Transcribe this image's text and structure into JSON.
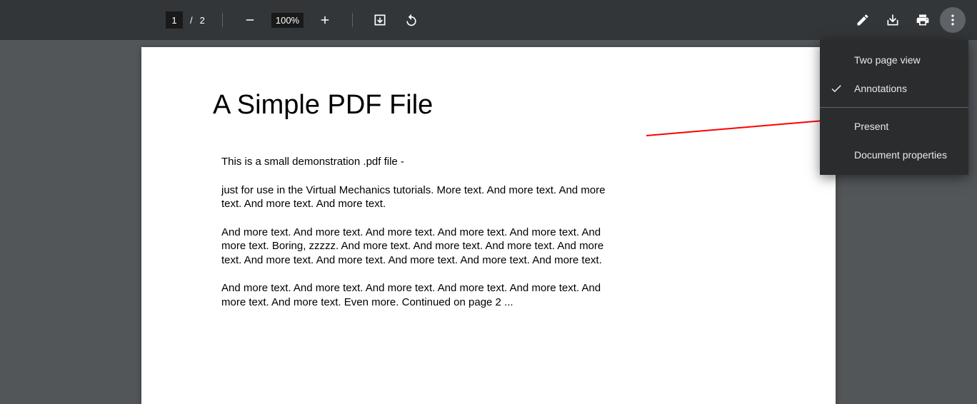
{
  "toolbar": {
    "page_current": "1",
    "page_separator": "/",
    "page_total": "2",
    "zoom_level": "100%"
  },
  "document": {
    "title": "A Simple PDF File",
    "paragraphs": [
      "This is a small demonstration .pdf file -",
      "just for use in the Virtual Mechanics tutorials. More text. And more text. And more text. And more text. And more text.",
      "And more text. And more text. And more text. And more text. And more text. And more text. Boring, zzzzz. And more text. And more text. And more text. And more text. And more text. And more text. And more text. And more text. And more text.",
      "And more text. And more text. And more text. And more text. And more text. And more text. And more text. Even more. Continued on page 2 ..."
    ]
  },
  "menu": {
    "items": [
      {
        "label": "Two page view",
        "checked": false
      },
      {
        "label": "Annotations",
        "checked": true
      },
      {
        "label": "Present",
        "checked": false
      },
      {
        "label": "Document properties",
        "checked": false
      }
    ]
  }
}
